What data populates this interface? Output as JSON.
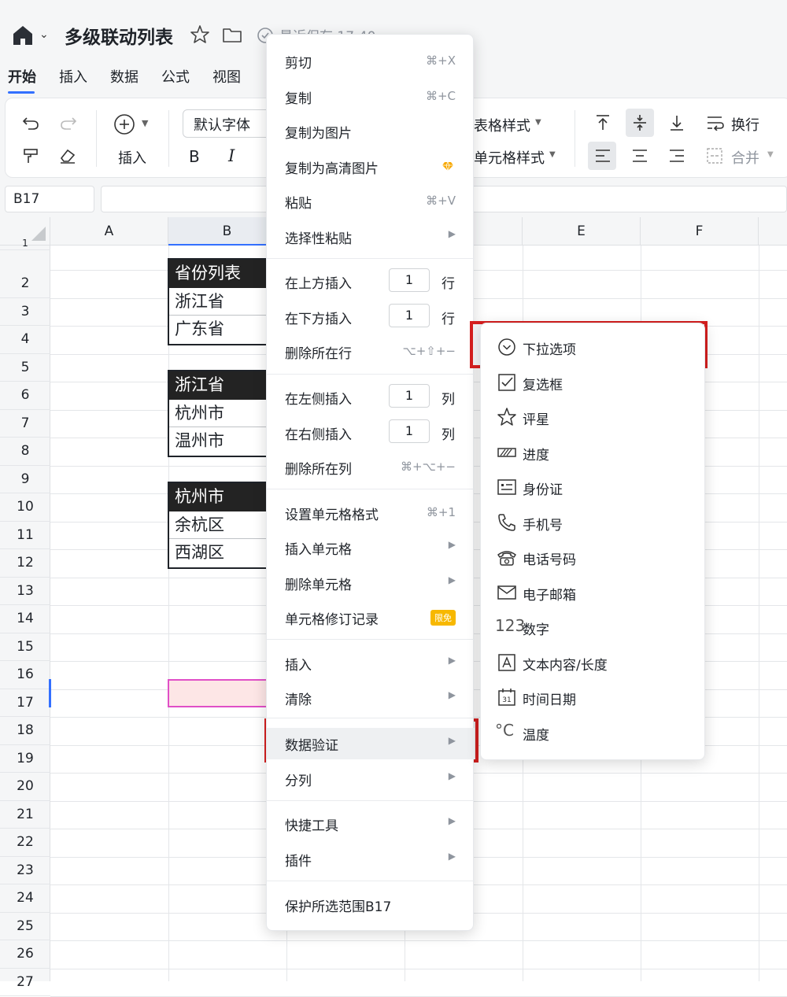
{
  "titlebar": {
    "doc_title": "多级联动列表",
    "saved_text": "最近保存 17:40"
  },
  "tabs": [
    "开始",
    "插入",
    "数据",
    "公式",
    "视图"
  ],
  "toolbar": {
    "insert_label": "插入",
    "font_name": "默认字体",
    "bold": "B",
    "italic": "I",
    "table_style": "表格样式",
    "cell_style": "单元格样式",
    "wrap": "换行",
    "merge": "合并"
  },
  "formula_bar": {
    "cell_ref": "B17",
    "formula": ""
  },
  "columns": [
    "A",
    "B",
    "E",
    "F"
  ],
  "rows": [
    "1",
    "2",
    "3",
    "4",
    "5",
    "6",
    "7",
    "8",
    "9",
    "10",
    "11",
    "12",
    "13",
    "14",
    "15",
    "16",
    "17",
    "18",
    "19",
    "20",
    "21",
    "22",
    "23",
    "24",
    "25",
    "26",
    "27"
  ],
  "tables": [
    {
      "header": "省份列表",
      "items": [
        "浙江省",
        "广东省"
      ]
    },
    {
      "header": "浙江省",
      "items": [
        "杭州市",
        "温州市"
      ]
    },
    {
      "header": "杭州市",
      "items": [
        "余杭区",
        "西湖区"
      ]
    }
  ],
  "context_menu": {
    "cut": {
      "label": "剪切",
      "shortcut": "⌘+X"
    },
    "copy": {
      "label": "复制",
      "shortcut": "⌘+C"
    },
    "copy_image": {
      "label": "复制为图片"
    },
    "copy_hd_image": {
      "label": "复制为高清图片"
    },
    "paste": {
      "label": "粘贴",
      "shortcut": "⌘+V"
    },
    "paste_special": {
      "label": "选择性粘贴"
    },
    "insert_above": {
      "label": "在上方插入",
      "value": "1",
      "unit": "行"
    },
    "insert_below": {
      "label": "在下方插入",
      "value": "1",
      "unit": "行"
    },
    "delete_row": {
      "label": "删除所在行",
      "shortcut": "⌥+⇧+−"
    },
    "insert_left": {
      "label": "在左侧插入",
      "value": "1",
      "unit": "列"
    },
    "insert_right": {
      "label": "在右侧插入",
      "value": "1",
      "unit": "列"
    },
    "delete_col": {
      "label": "删除所在列",
      "shortcut": "⌘+⌥+−"
    },
    "format_cells": {
      "label": "设置单元格格式",
      "shortcut": "⌘+1"
    },
    "insert_cells": {
      "label": "插入单元格"
    },
    "delete_cells": {
      "label": "删除单元格"
    },
    "cell_history": {
      "label": "单元格修订记录",
      "badge": "限免"
    },
    "insert": {
      "label": "插入"
    },
    "clear": {
      "label": "清除"
    },
    "data_validation": {
      "label": "数据验证"
    },
    "split": {
      "label": "分列"
    },
    "quick_tools": {
      "label": "快捷工具"
    },
    "plugins": {
      "label": "插件"
    },
    "protect": {
      "label": "保护所选范围B17"
    }
  },
  "submenu": {
    "items": [
      "下拉选项",
      "复选框",
      "评星",
      "进度",
      "身份证",
      "手机号",
      "电话号码",
      "电子邮箱",
      "数字",
      "文本内容/长度",
      "时间日期",
      "温度"
    ]
  },
  "colors": {
    "accent": "#3370ff",
    "highlight_border": "#d61f1f",
    "selected_cell_border": "#e04fc7",
    "selected_cell_fill": "#fde6e6"
  }
}
